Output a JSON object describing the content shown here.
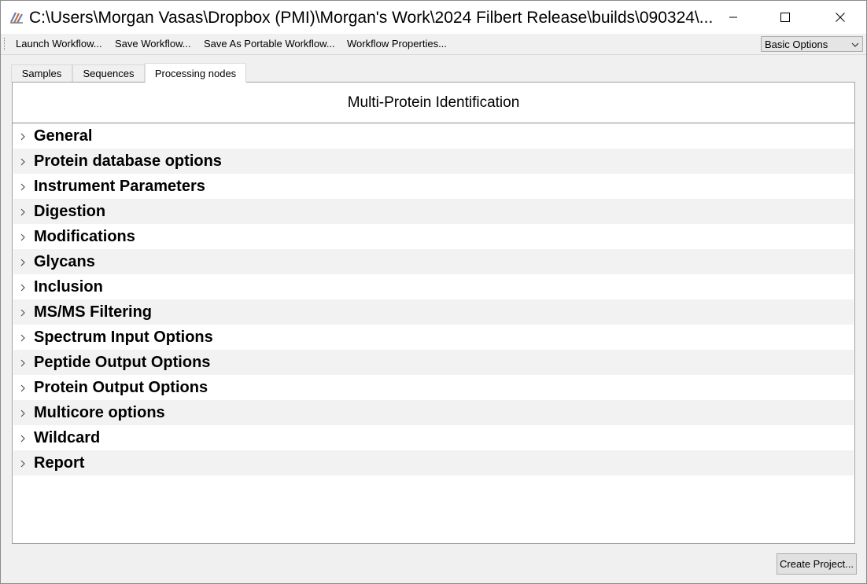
{
  "window": {
    "title": "C:\\Users\\Morgan Vasas\\Dropbox (PMI)\\Morgan's Work\\2024 Filbert Release\\builds\\090324\\...",
    "icons": {
      "app": "app-logo-icon",
      "minimize": "minimize-icon",
      "maximize": "maximize-icon",
      "close": "close-icon"
    }
  },
  "toolbar": {
    "launch": "Launch Workflow...",
    "save": "Save Workflow...",
    "save_portable": "Save As Portable Workflow...",
    "properties": "Workflow Properties...",
    "options_select": {
      "value": "Basic Options"
    }
  },
  "tabs": [
    {
      "label": "Samples",
      "active": false
    },
    {
      "label": "Sequences",
      "active": false
    },
    {
      "label": "Processing nodes",
      "active": true
    }
  ],
  "panel": {
    "title": "Multi-Protein Identification",
    "sections": [
      {
        "label": "General"
      },
      {
        "label": "Protein database options"
      },
      {
        "label": "Instrument Parameters"
      },
      {
        "label": "Digestion"
      },
      {
        "label": "Modifications"
      },
      {
        "label": "Glycans"
      },
      {
        "label": "Inclusion"
      },
      {
        "label": "MS/MS Filtering"
      },
      {
        "label": "Spectrum Input Options"
      },
      {
        "label": "Peptide Output Options"
      },
      {
        "label": "Protein Output Options"
      },
      {
        "label": "Multicore options"
      },
      {
        "label": "Wildcard"
      },
      {
        "label": "Report"
      }
    ]
  },
  "footer": {
    "create_project": "Create Project..."
  },
  "colors": {
    "alt_row": "#f2f2f2",
    "panel_bg": "#ffffff",
    "window_bg": "#f0f0f0"
  }
}
